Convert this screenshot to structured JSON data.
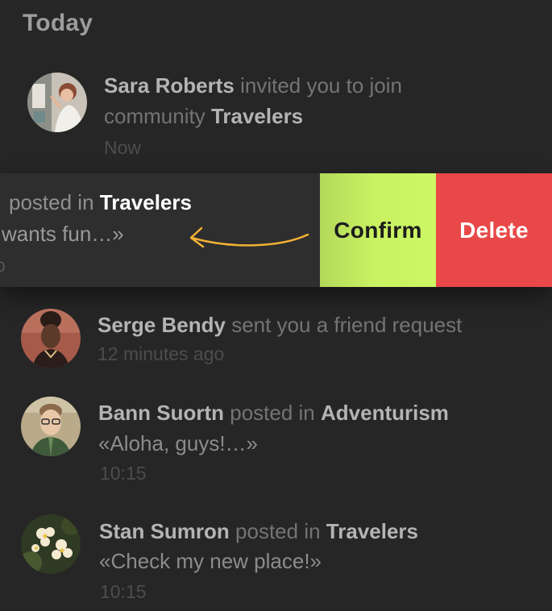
{
  "section": {
    "title": "Today"
  },
  "notifications": [
    {
      "name": "Sara Roberts",
      "action": "invited you to join",
      "action2": "community",
      "target": "Travelers",
      "time": "Now",
      "avatar": "woman-painting-avatar"
    },
    {
      "action": "posted in",
      "target": "Travelers",
      "quote": "wants fun…»",
      "time": "o",
      "swipe_actions": {
        "confirm_label": "Confirm",
        "delete_label": "Delete"
      }
    },
    {
      "name": "Serge Bendy",
      "action": "sent you a friend request",
      "time": "12 minutes ago",
      "avatar": "woman-portrait-avatar"
    },
    {
      "name": "Bann Suortn",
      "action": "posted in",
      "target": "Adventurism",
      "quote": "«Aloha, guys!…»",
      "time": "10:15",
      "avatar": "man-glasses-avatar"
    },
    {
      "name": "Stan Sumron",
      "action": "posted in",
      "target": "Travelers",
      "quote": "«Check my new place!»",
      "time": "10:15",
      "avatar": "flowers-avatar"
    }
  ],
  "colors": {
    "background": "#262626",
    "confirm": "#c9f162",
    "delete": "#e94848",
    "arrow": "#f2b134"
  }
}
